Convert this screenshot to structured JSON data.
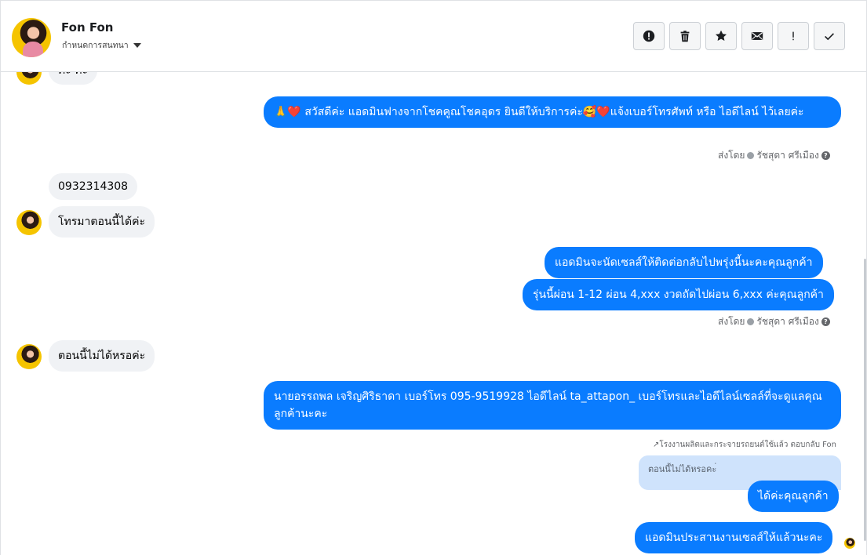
{
  "header": {
    "contact_name": "Fon Fon",
    "status_menu": "กำหนดการสนทนา"
  },
  "actions": [
    {
      "icon": "alert-circle-icon"
    },
    {
      "icon": "trash-icon"
    },
    {
      "icon": "star-icon"
    },
    {
      "icon": "envelope-icon"
    },
    {
      "icon": "exclamation-icon"
    },
    {
      "icon": "checkmark-icon"
    }
  ],
  "messages": {
    "partial_top": "ค่ะ ค่ะ",
    "out_greeting": "🙏❤️ สวัสดีค่ะ แอดมินฟางจากโชคคูณโชคอุดร ยินดีให้บริการค่ะ🥰❤️แจ้งเบอร์โทรศัพท์ หรือ ไอดีไลน์  ไว้เลยค่ะ",
    "sent_by_1": "ส่งโดย",
    "sent_by_name_1": "รัชสุดา ศรีเมือง",
    "in_phone": "0932314308",
    "in_call_now": "โทรมาตอนนี้ได้ค่ะ",
    "out_schedule": "แอดมินจะนัดเซลส์ให้ติดต่อกลับไปพรุ่งนี้นะคะคุณลูกค้า",
    "out_installment": "รุ่นนี้ผ่อน 1-12 ผ่อน 4,xxx งวดถัดไปผ่อน 6,xxx ค่ะคุณลูกค้า",
    "sent_by_2": "ส่งโดย",
    "sent_by_name_2": "รัชสุดา ศรีเมือง",
    "in_not_now": "ตอนนี้ไม่ได้หรอค่ะ",
    "out_sales_contact": "นายอรรถพล เจริญศิริธาดา     เบอร์โทร 095-9519928 ไอดีไลน์ ta_attapon_    เบอร์โทรและไอดีไลน์เซลล์ที่จะดูแลคุณลูกค้านะคะ",
    "reply_note": "↗โรงงานผลิตและกระจายรถยนต์ใช้แล้ว ตอบกลับ Fon",
    "quoted_text": "ตอนนี้ไม่ได้หรอคะ่",
    "out_ok": "ได้ค่ะคุณลูกค้า",
    "out_coordinated": "แอดมินประสานงานเซลส์ให้แล้วนะคะ"
  },
  "colors": {
    "outgoing_bubble": "#0a7cff",
    "incoming_bubble": "#f0f2f5",
    "quoted_bubble": "#cfe3fc"
  }
}
